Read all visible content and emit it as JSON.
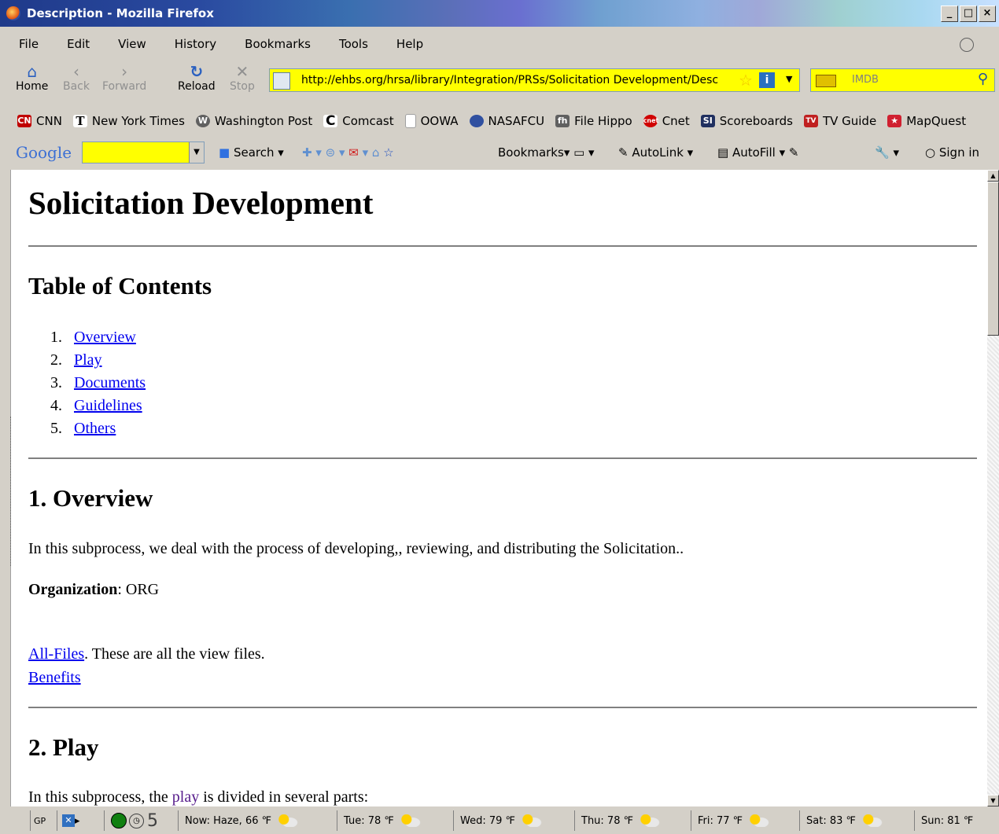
{
  "window": {
    "title": "Description - Mozilla Firefox",
    "min": "_",
    "max": "□",
    "close": "×"
  },
  "menu": [
    "File",
    "Edit",
    "View",
    "History",
    "Bookmarks",
    "Tools",
    "Help"
  ],
  "nav": {
    "home": "Home",
    "back": "Back",
    "forward": "Forward",
    "reload": "Reload",
    "stop": "Stop",
    "url": "http://ehbs.org/hrsa/library/Integration/PRSs/Solicitation Development/Desc",
    "search_placeholder": "IMDB"
  },
  "bookmarks": [
    {
      "label": "CNN",
      "icon": "cnn-icon"
    },
    {
      "label": "New York Times",
      "icon": "nyt-icon"
    },
    {
      "label": "Washington Post",
      "icon": "washington-post-icon"
    },
    {
      "label": "Comcast",
      "icon": "comcast-icon"
    },
    {
      "label": "OOWA",
      "icon": "page-icon"
    },
    {
      "label": "NASAFCU",
      "icon": "nasafcu-icon"
    },
    {
      "label": "File Hippo",
      "icon": "filehippo-icon"
    },
    {
      "label": "Cnet",
      "icon": "cnet-icon"
    },
    {
      "label": "Scoreboards",
      "icon": "si-icon"
    },
    {
      "label": "TV Guide",
      "icon": "tvguide-icon"
    },
    {
      "label": "MapQuest",
      "icon": "mapquest-icon"
    }
  ],
  "google_toolbar": {
    "logo": "Google",
    "search": "Search",
    "bookmarks": "Bookmarks",
    "autolink": "AutoLink",
    "autofill": "AutoFill",
    "signin": "Sign in"
  },
  "page": {
    "title": "Solicitation Development",
    "toc_heading": "Table of Contents",
    "toc": [
      {
        "num": "1.",
        "label": "Overview"
      },
      {
        "num": "2.",
        "label": "Play"
      },
      {
        "num": "3.",
        "label": "Documents"
      },
      {
        "num": "4.",
        "label": "Guidelines"
      },
      {
        "num": "5.",
        "label": "Others"
      }
    ],
    "overview_heading": "1. Overview",
    "overview_text": "In this subprocess, we deal with the process of developing,, reviewing, and distributing the Solicitation..",
    "org_label": "Organization",
    "org_value": ": ORG",
    "allfiles_link": "All-Files",
    "allfiles_text": ". These are all the view files.",
    "benefits_link": "Benefits",
    "play_heading": "2. Play",
    "play_text_before": "In this subprocess, the ",
    "play_link": "play",
    "play_text_after": " is divided in several parts:"
  },
  "status": {
    "gp": "GP",
    "count": "5",
    "weather": [
      {
        "label": "Now: Haze, 66 ℉"
      },
      {
        "label": "Tue: 78 ℉"
      },
      {
        "label": "Wed: 79 ℉"
      },
      {
        "label": "Thu: 78 ℉"
      },
      {
        "label": "Fri: 77 ℉"
      },
      {
        "label": "Sat: 83 ℉"
      },
      {
        "label": "Sun: 81 ℉"
      }
    ]
  }
}
